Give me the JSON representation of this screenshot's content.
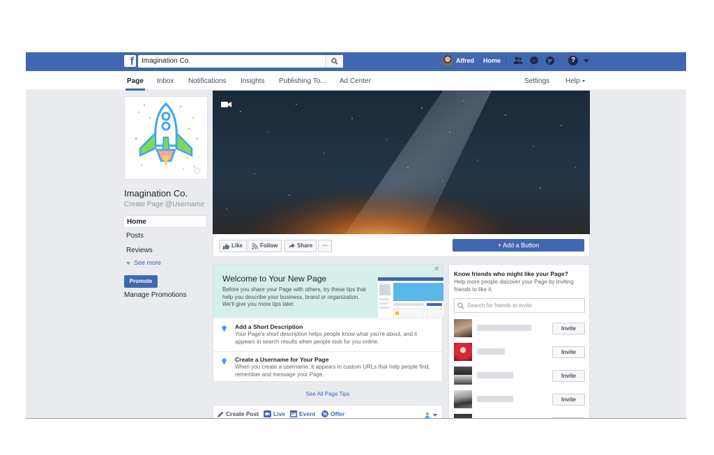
{
  "topbar": {
    "search_value": "Imagination Co.",
    "user_name": "Alfred",
    "home_label": "Home"
  },
  "subnav": {
    "tabs": [
      "Page",
      "Inbox",
      "Notifications",
      "Insights",
      "Publishing To...",
      "Ad Center"
    ],
    "settings_label": "Settings",
    "help_label": "Help"
  },
  "sidebar": {
    "page_name": "Imagination Co.",
    "username_prompt": "Create Page @Username",
    "items": [
      "Home",
      "Posts",
      "Reviews"
    ],
    "see_more": "See more",
    "promote": "Promote",
    "manage_promotions": "Manage Promotions"
  },
  "actions": {
    "like": "Like",
    "follow": "Follow",
    "share": "Share",
    "more": "···",
    "add_button": "+ Add a Button"
  },
  "welcome": {
    "title": "Welcome to Your New Page",
    "description": "Before you share your Page with others, try these tips that help you describe your business, brand or organization. We'll give you more tips later.",
    "tips": [
      {
        "title": "Add a Short Description",
        "text": "Your Page's short description helps people know what you're about, and it appears in search results when people look for you online."
      },
      {
        "title": "Create a Username for Your Page",
        "text": "When you create a username, it appears in custom URLs that help people find, remember and message your Page."
      }
    ],
    "see_all": "See All Page Tips"
  },
  "composer": {
    "create_post": "Create Post",
    "live": "Live",
    "event": "Event",
    "offer": "Offer"
  },
  "friends": {
    "title": "Know friends who might like your Page?",
    "description": "Help more people discover your Page by inviting friends to like it.",
    "search_placeholder": "Search for friends to invite",
    "invite_label": "Invite"
  },
  "colors": {
    "brand_blue": "#4267b2",
    "welcome_bg": "#d5f0ea",
    "page_bg": "#e9ebee"
  }
}
